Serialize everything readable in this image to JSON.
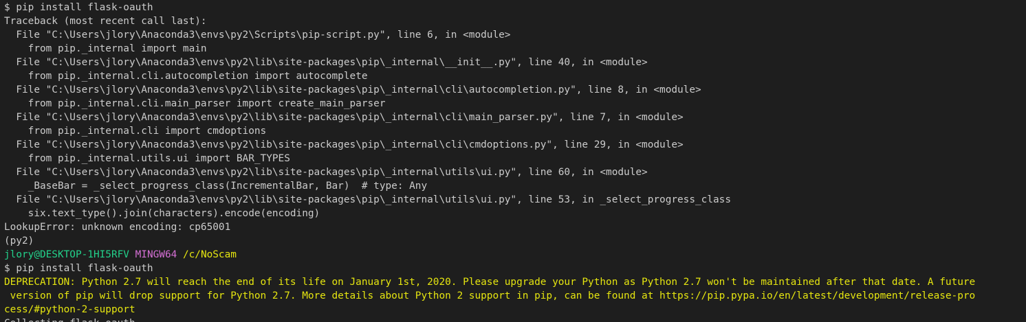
{
  "colors": {
    "background": "#1e1e1e",
    "text": "#cccccc",
    "prompt_user": "#23d18b",
    "prompt_system": "#d670d6",
    "prompt_path": "#e5e510",
    "warning": "#e5e510"
  },
  "terminal": {
    "lines": [
      "$ pip install flask-oauth",
      "Traceback (most recent call last):",
      "  File \"C:\\Users\\jlory\\Anaconda3\\envs\\py2\\Scripts\\pip-script.py\", line 6, in <module>",
      "    from pip._internal import main",
      "  File \"C:\\Users\\jlory\\Anaconda3\\envs\\py2\\lib\\site-packages\\pip\\_internal\\__init__.py\", line 40, in <module>",
      "    from pip._internal.cli.autocompletion import autocomplete",
      "  File \"C:\\Users\\jlory\\Anaconda3\\envs\\py2\\lib\\site-packages\\pip\\_internal\\cli\\autocompletion.py\", line 8, in <module>",
      "    from pip._internal.cli.main_parser import create_main_parser",
      "  File \"C:\\Users\\jlory\\Anaconda3\\envs\\py2\\lib\\site-packages\\pip\\_internal\\cli\\main_parser.py\", line 7, in <module>",
      "    from pip._internal.cli import cmdoptions",
      "  File \"C:\\Users\\jlory\\Anaconda3\\envs\\py2\\lib\\site-packages\\pip\\_internal\\cli\\cmdoptions.py\", line 29, in <module>",
      "    from pip._internal.utils.ui import BAR_TYPES",
      "  File \"C:\\Users\\jlory\\Anaconda3\\envs\\py2\\lib\\site-packages\\pip\\_internal\\utils\\ui.py\", line 60, in <module>",
      "    _BaseBar = _select_progress_class(IncrementalBar, Bar)  # type: Any",
      "  File \"C:\\Users\\jlory\\Anaconda3\\envs\\py2\\lib\\site-packages\\pip\\_internal\\utils\\ui.py\", line 53, in _select_progress_class",
      "    six.text_type().join(characters).encode(encoding)",
      "LookupError: unknown encoding: cp65001",
      "(py2)"
    ],
    "prompt": {
      "user_host": "jlory@DESKTOP-1HI5RFV",
      "system": "MINGW64",
      "path": "/c/NoScam"
    },
    "command2": "$ pip install flask-oauth",
    "deprecation": [
      "DEPRECATION: Python 2.7 will reach the end of its life on January 1st, 2020. Please upgrade your Python as Python 2.7 won't be maintained after that date. A future",
      " version of pip will drop support for Python 2.7. More details about Python 2 support in pip, can be found at https://pip.pypa.io/en/latest/development/release-pro",
      "cess/#python-2-support"
    ],
    "partial_line": "Collecting flask-oauth"
  }
}
